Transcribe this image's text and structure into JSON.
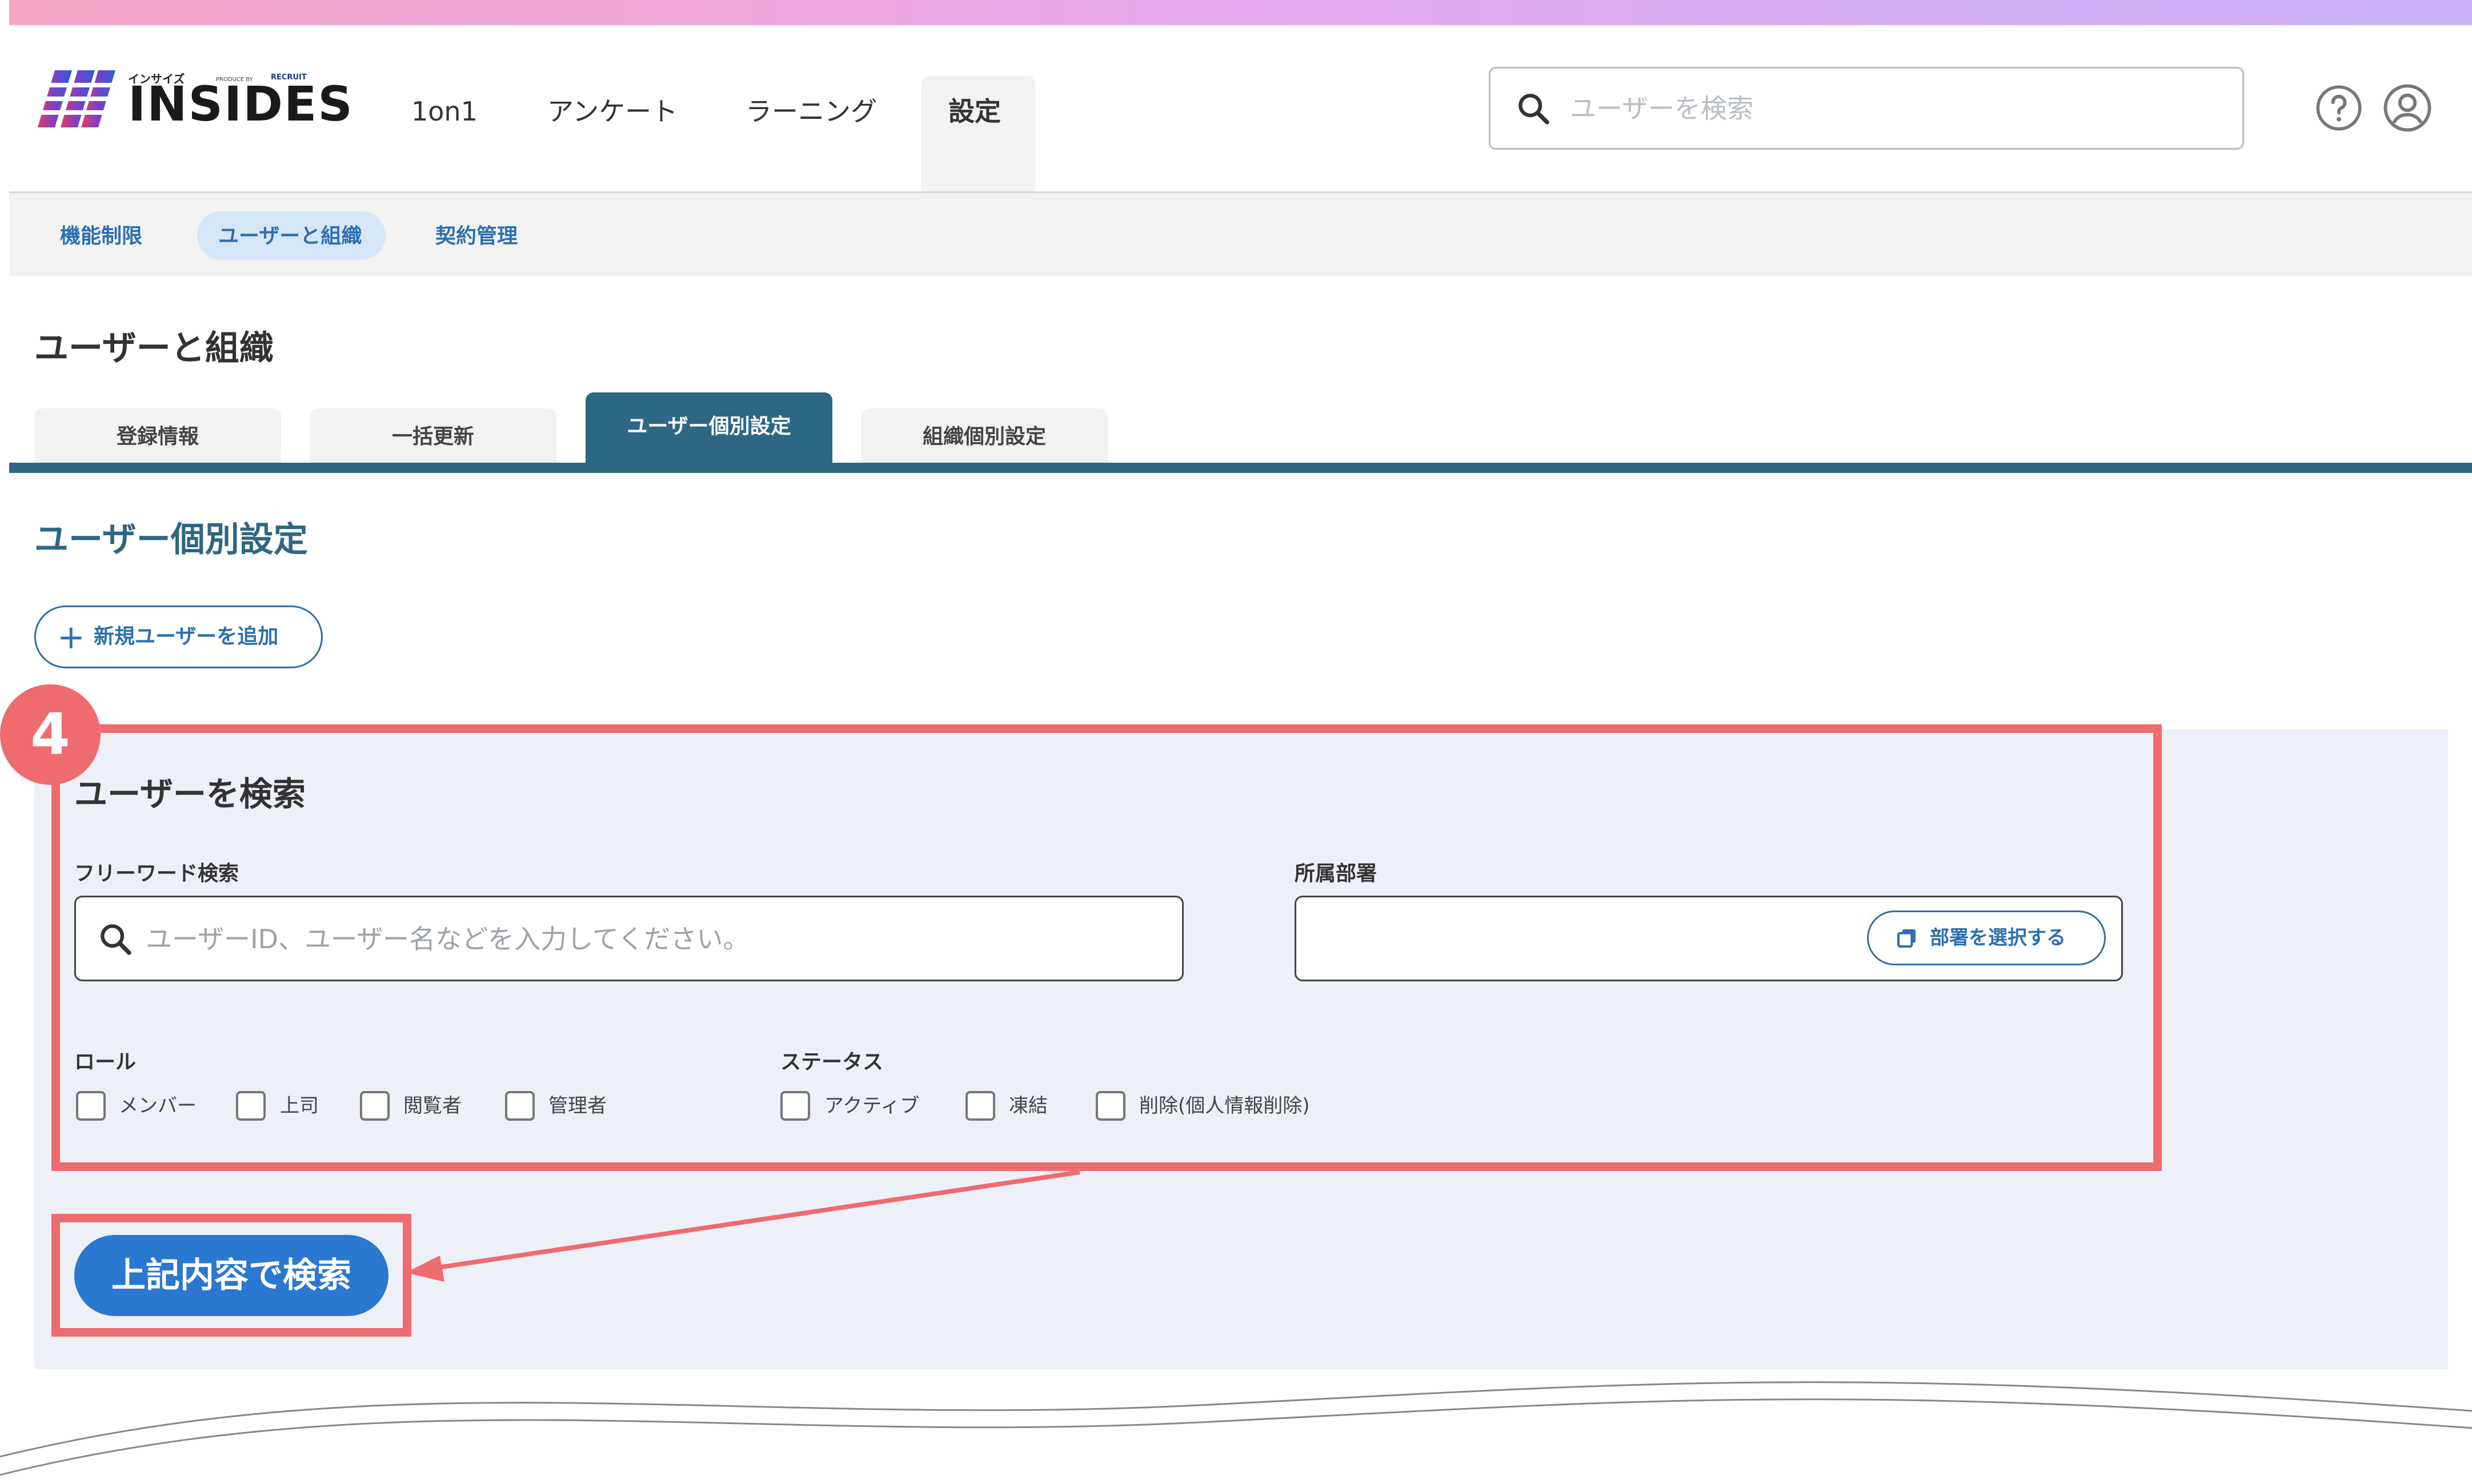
{
  "header": {
    "logo_small": "インサイズ",
    "logo_produce": "PRODUCE BY",
    "logo_recruit": "RECRUIT",
    "logo_text": "INSIDES",
    "nav": [
      "1on1",
      "アンケート",
      "ラーニング",
      "設定"
    ],
    "search_placeholder": "ユーザーを検索",
    "help_icon": "help-circle-icon",
    "user_icon": "user-circle-icon"
  },
  "subnav": [
    "機能制限",
    "ユーザーと組織",
    "契約管理"
  ],
  "page_title": "ユーザーと組織",
  "tabs": [
    "登録情報",
    "一括更新",
    "ユーザー個別設定",
    "組織個別設定"
  ],
  "section_title": "ユーザー個別設定",
  "add_user": {
    "icon": "+",
    "label": "新規ユーザーを追加"
  },
  "step_number": "4",
  "search": {
    "heading": "ユーザーを検索",
    "freeword_label": "フリーワード検索",
    "freeword_placeholder": "ユーザーID、ユーザー名などを入力してください。",
    "dept_label": "所属部署",
    "dept_button": "部署を選択する",
    "role_label": "ロール",
    "roles": [
      "メンバー",
      "上司",
      "閲覧者",
      "管理者"
    ],
    "status_label": "ステータス",
    "statuses": [
      "アクティブ",
      "凍結",
      "削除(個人情報削除)"
    ],
    "submit": "上記内容で検索"
  },
  "colors": {
    "accent_red": "#ee6b6f",
    "primary_blue": "#2a78cf",
    "tab_active": "#2e6784"
  }
}
